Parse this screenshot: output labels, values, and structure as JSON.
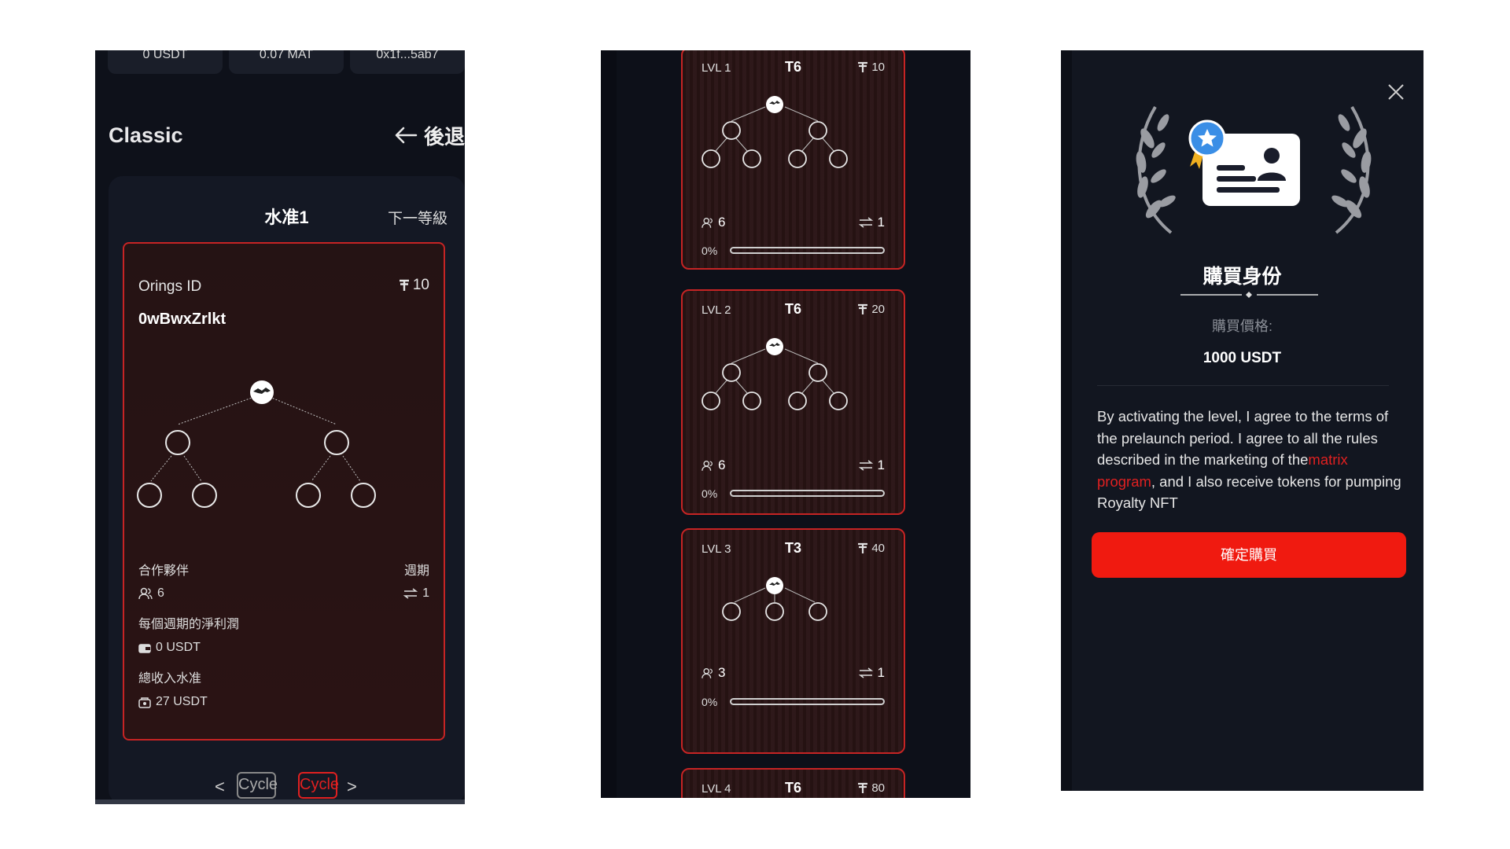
{
  "panel_a": {
    "top_chips": [
      "0 USDT",
      "0.07 MAT",
      "0x1f...5ab7"
    ],
    "title": "Classic",
    "back_label": "後退",
    "level_title": "水准1",
    "next_level": "下一等級",
    "card": {
      "id_label": "Orings ID",
      "price": "10",
      "id_value": "0wBwxZrlkt",
      "partners_label": "合作夥伴",
      "cycle_label": "週期",
      "partners_count": "6",
      "cycle_count": "1",
      "net_profit_label": "每個週期的淨利潤",
      "net_profit_value": "0 USDT",
      "total_income_label": "總收入水准",
      "total_income_value": "27 USDT"
    },
    "pager": {
      "prev": "<",
      "next": ">",
      "items": [
        "Cycle",
        "Cycle"
      ],
      "active_index": 1
    }
  },
  "panel_b": {
    "levels": [
      {
        "lvl": "LVL 1",
        "tier": "T6",
        "price": "10",
        "partners": "6",
        "cycles": "1",
        "progress_label": "0%",
        "progress": 0,
        "tree": "binary"
      },
      {
        "lvl": "LVL 2",
        "tier": "T6",
        "price": "20",
        "partners": "6",
        "cycles": "1",
        "progress_label": "0%",
        "progress": 0,
        "tree": "binary"
      },
      {
        "lvl": "LVL 3",
        "tier": "T3",
        "price": "40",
        "partners": "3",
        "cycles": "1",
        "progress_label": "0%",
        "progress": 0,
        "tree": "ternary"
      },
      {
        "lvl": "LVL 4",
        "tier": "T6",
        "price": "80"
      }
    ]
  },
  "panel_c": {
    "title": "購買身份",
    "price_label": "購買價格:",
    "price_value": "1000 USDT",
    "terms_before": "By activating the level, I agree to the terms of the prelaunch period. I agree to all the rules described in the marketing of the",
    "terms_link": "matrix program",
    "terms_after": ", and I also receive tokens for pumping Royalty NFT",
    "confirm_label": "確定購買"
  },
  "colors": {
    "accent": "#e02020",
    "panel_bg": "#0e111a",
    "card_bg": "#2a1415",
    "button": "#f01a10"
  },
  "icons": [
    "arrow-left-icon",
    "tether-icon",
    "partners-icon",
    "cycle-icon",
    "wallet-icon",
    "income-icon",
    "close-icon",
    "id-card-icon",
    "laurel-icon",
    "star-badge-icon",
    "avatar-node-icon"
  ]
}
